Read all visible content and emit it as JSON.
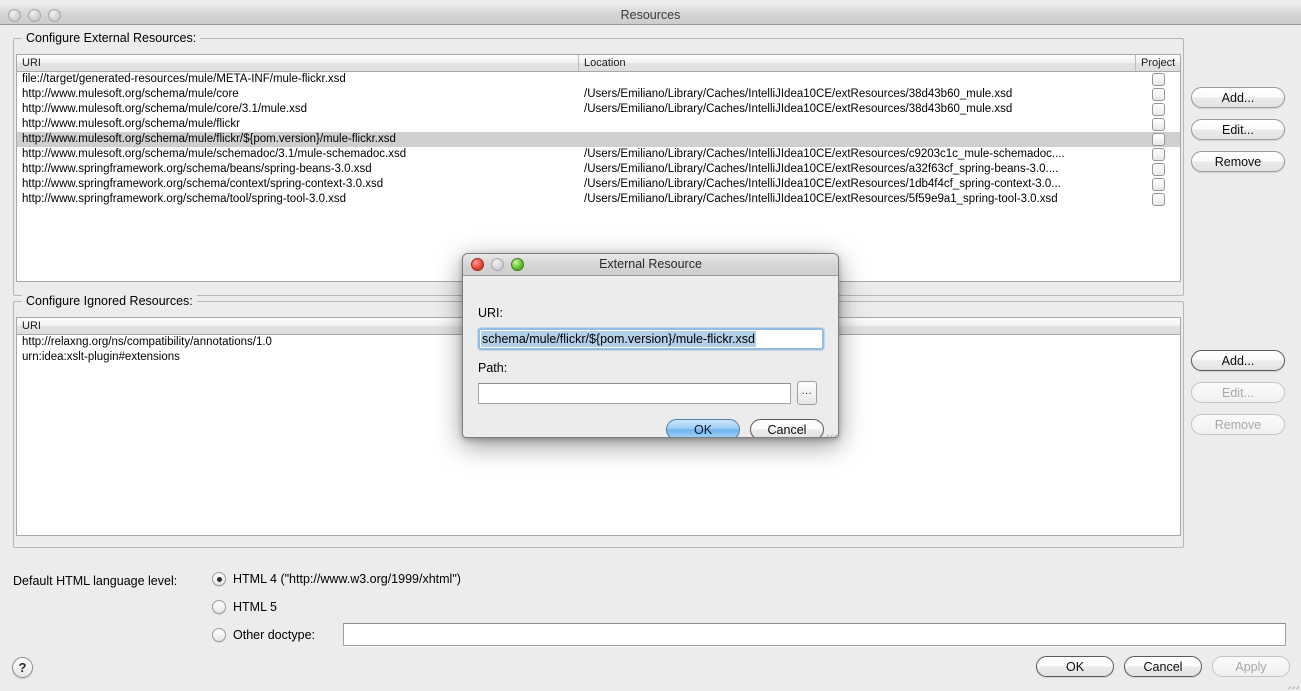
{
  "background_window": {
    "bleed_text_blue": "::.:: .: ::.:: ..:. .:::",
    "bleed_text_red": ".::: : :.::: .:: :..::: .::::.:::. :.: :: .:.::"
  },
  "window": {
    "title": "Resources",
    "traffic_lights": [
      "close-disabled",
      "minimize-disabled",
      "zoom-disabled"
    ]
  },
  "external_section": {
    "legend": "Configure External Resources:",
    "columns": [
      "URI",
      "Location",
      "Project"
    ],
    "rows": [
      {
        "uri": "file://target/generated-resources/mule/META-INF/mule-flickr.xsd",
        "location": "",
        "project": false,
        "selected": false
      },
      {
        "uri": "http://www.mulesoft.org/schema/mule/core",
        "location": "/Users/Emiliano/Library/Caches/IntelliJIdea10CE/extResources/38d43b60_mule.xsd",
        "project": false,
        "selected": false
      },
      {
        "uri": "http://www.mulesoft.org/schema/mule/core/3.1/mule.xsd",
        "location": "/Users/Emiliano/Library/Caches/IntelliJIdea10CE/extResources/38d43b60_mule.xsd",
        "project": false,
        "selected": false
      },
      {
        "uri": "http://www.mulesoft.org/schema/mule/flickr",
        "location": "",
        "project": false,
        "selected": false
      },
      {
        "uri": "http://www.mulesoft.org/schema/mule/flickr/${pom.version}/mule-flickr.xsd",
        "location": "",
        "project": false,
        "selected": true
      },
      {
        "uri": "http://www.mulesoft.org/schema/mule/schemadoc/3.1/mule-schemadoc.xsd",
        "location": "/Users/Emiliano/Library/Caches/IntelliJIdea10CE/extResources/c9203c1c_mule-schemadoc....",
        "project": false,
        "selected": false
      },
      {
        "uri": "http://www.springframework.org/schema/beans/spring-beans-3.0.xsd",
        "location": "/Users/Emiliano/Library/Caches/IntelliJIdea10CE/extResources/a32f63cf_spring-beans-3.0....",
        "project": false,
        "selected": false
      },
      {
        "uri": "http://www.springframework.org/schema/context/spring-context-3.0.xsd",
        "location": "/Users/Emiliano/Library/Caches/IntelliJIdea10CE/extResources/1db4f4cf_spring-context-3.0...",
        "project": false,
        "selected": false
      },
      {
        "uri": "http://www.springframework.org/schema/tool/spring-tool-3.0.xsd",
        "location": "/Users/Emiliano/Library/Caches/IntelliJIdea10CE/extResources/5f59e9a1_spring-tool-3.0.xsd",
        "project": false,
        "selected": false
      }
    ],
    "buttons": {
      "add": "Add...",
      "edit": "Edit...",
      "remove": "Remove"
    }
  },
  "ignored_section": {
    "legend": "Configure Ignored Resources:",
    "columns": [
      "URI"
    ],
    "rows": [
      {
        "uri": "http://relaxng.org/ns/compatibility/annotations/1.0"
      },
      {
        "uri": "urn:idea:xslt-plugin#extensions"
      }
    ],
    "buttons": {
      "add": "Add...",
      "edit": "Edit...",
      "remove": "Remove"
    }
  },
  "doctype_section": {
    "label": "Default HTML language level:",
    "options": [
      {
        "label": "HTML 4 (\"http://www.w3.org/1999/xhtml\")",
        "selected": true
      },
      {
        "label": "HTML 5",
        "selected": false
      },
      {
        "label": "Other doctype:",
        "selected": false
      }
    ],
    "other_doctype_value": ""
  },
  "footer": {
    "help": "?",
    "ok": "OK",
    "cancel": "Cancel",
    "apply": "Apply"
  },
  "modal": {
    "title": "External Resource",
    "traffic_lights": [
      "close-enabled",
      "minimize-disabled",
      "zoom-enabled"
    ],
    "uri_label": "URI:",
    "uri_value": "schema/mule/flickr/${pom.version}/mule-flickr.xsd",
    "uri_selected": true,
    "path_label": "Path:",
    "path_value": "",
    "browse_label": "…",
    "ok": "OK",
    "cancel": "Cancel"
  },
  "colors": {
    "window_bg": "#ececec",
    "selection_row": "#cfcfcf",
    "text_selection": "#b4cfe8",
    "focus_ring": "#93bde2",
    "default_button": "#9ccdf5"
  }
}
